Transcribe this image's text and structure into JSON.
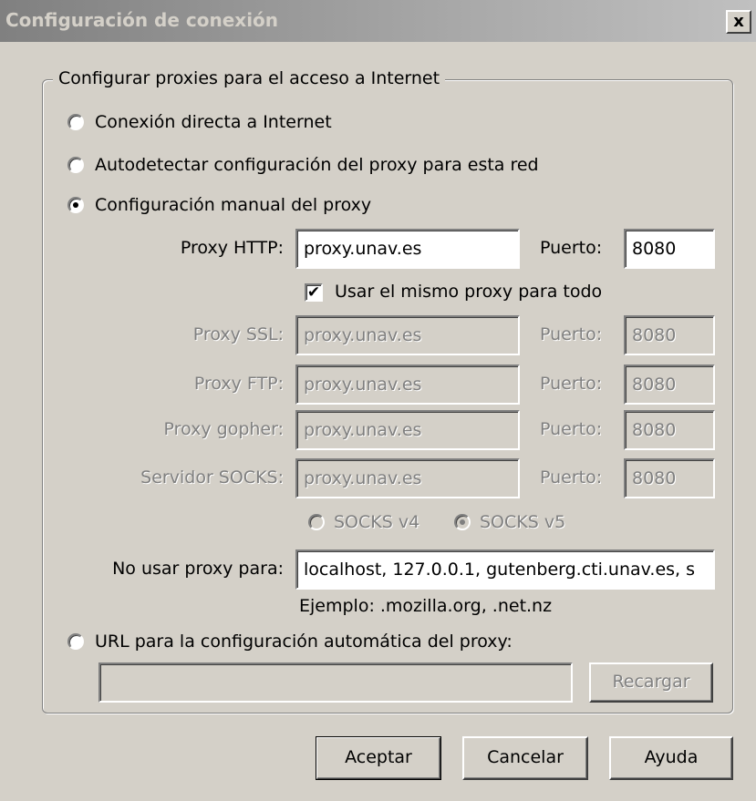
{
  "window": {
    "title": "Configuración de conexión",
    "close_glyph": "x"
  },
  "group": {
    "legend": "Configurar proxies para el acceso a Internet"
  },
  "options": {
    "direct": "Conexión directa a Internet",
    "autodetect": "Autodetectar configuración del proxy para esta red",
    "manual": "Configuración manual del proxy",
    "auto_url": "URL para la configuración automática del proxy:",
    "selected": "manual"
  },
  "manual": {
    "http": {
      "label": "Proxy HTTP:",
      "value": "proxy.unav.es",
      "port_label": "Puerto:",
      "port": "8080"
    },
    "same_proxy": {
      "label": "Usar el mismo proxy para todo",
      "checked": true
    },
    "ssl": {
      "label": "Proxy SSL:",
      "value": "proxy.unav.es",
      "port_label": "Puerto:",
      "port": "8080"
    },
    "ftp": {
      "label": "Proxy FTP:",
      "value": "proxy.unav.es",
      "port_label": "Puerto:",
      "port": "8080"
    },
    "gopher": {
      "label": "Proxy gopher:",
      "value": "proxy.unav.es",
      "port_label": "Puerto:",
      "port": "8080"
    },
    "socks": {
      "label": "Servidor SOCKS:",
      "value": "proxy.unav.es",
      "port_label": "Puerto:",
      "port": "8080"
    },
    "socks_v4": "SOCKS v4",
    "socks_v5": "SOCKS v5",
    "socks_selected": "v5",
    "no_proxy_label": "No usar proxy para:",
    "no_proxy_value": "localhost, 127.0.0.1, gutenberg.cti.unav.es, s",
    "example": "Ejemplo: .mozilla.org, .net.nz"
  },
  "auto": {
    "url_value": "",
    "reload_label": "Recargar"
  },
  "buttons": {
    "ok": "Aceptar",
    "cancel": "Cancelar",
    "help": "Ayuda"
  }
}
